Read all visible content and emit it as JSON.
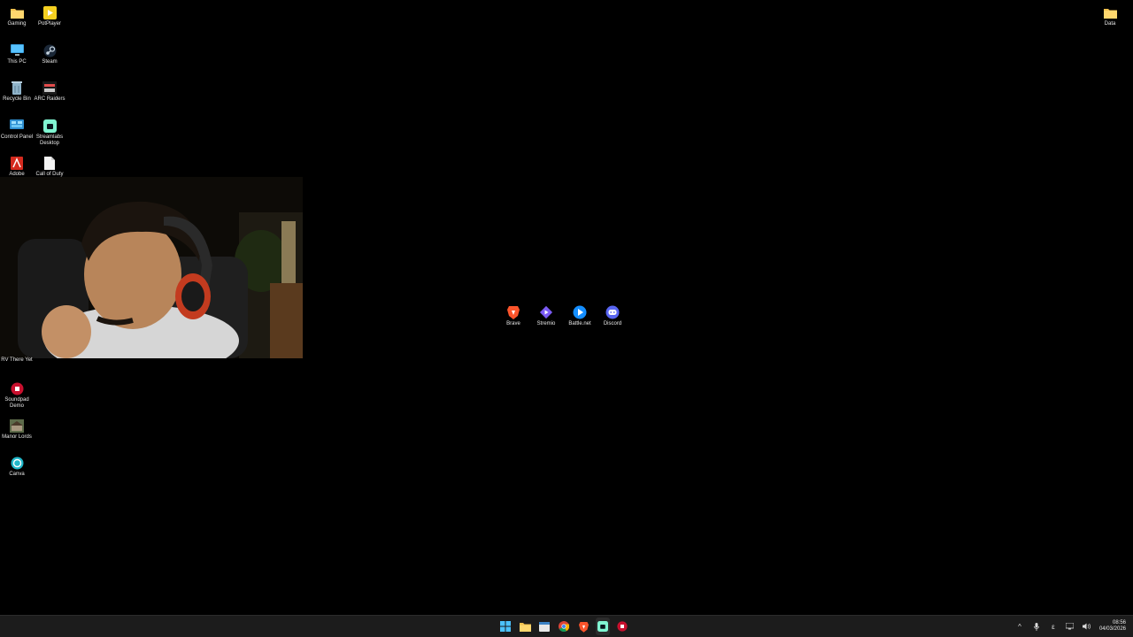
{
  "desktop": {
    "icons": [
      {
        "label": "Gaming",
        "icon": "folder-icon"
      },
      {
        "label": "PotPlayer",
        "icon": "potplayer-icon"
      },
      {
        "label": "This PC",
        "icon": "computer-icon"
      },
      {
        "label": "Steam",
        "icon": "steam-icon"
      },
      {
        "label": "Recycle Bin",
        "icon": "recycle-bin-icon"
      },
      {
        "label": "ARC Raiders",
        "icon": "arc-raiders-icon"
      },
      {
        "label": "Control Panel",
        "icon": "control-panel-icon"
      },
      {
        "label": "Streamlabs Desktop",
        "icon": "streamlabs-icon"
      },
      {
        "label": "Adobe",
        "icon": "adobe-icon"
      },
      {
        "label": "Call of Duty",
        "icon": "file-icon"
      },
      {
        "label": "RV There Yet",
        "icon": "game-icon"
      },
      {
        "label": "Soundpad Demo",
        "icon": "soundpad-icon"
      },
      {
        "label": "Manor Lords",
        "icon": "manor-lords-icon"
      },
      {
        "label": "Canva",
        "icon": "canva-icon"
      },
      {
        "label": "Data",
        "icon": "folder-icon"
      },
      {
        "label": "Brave",
        "icon": "brave-icon"
      },
      {
        "label": "Stremio",
        "icon": "stremio-icon"
      },
      {
        "label": "Battle.net",
        "icon": "battlenet-icon"
      },
      {
        "label": "Discord",
        "icon": "discord-icon"
      }
    ]
  },
  "webcam": {
    "description": "webcam-overlay"
  },
  "taskbar": {
    "apps": [
      {
        "icon": "start-icon"
      },
      {
        "icon": "file-explorer-icon"
      },
      {
        "icon": "calendar-app-icon"
      },
      {
        "icon": "chrome-icon"
      },
      {
        "icon": "brave-icon"
      },
      {
        "icon": "streamlabs-icon"
      },
      {
        "icon": "soundpad-icon"
      }
    ],
    "tray": {
      "chevron": "^",
      "language": "ε",
      "time": "08:56",
      "date": "04/03/2026"
    }
  },
  "colors": {
    "background": "#000000",
    "taskbar": "#1c1c1c",
    "folder": "#f2c14e",
    "brave": "#fb542b",
    "discord": "#5865f2",
    "stremio": "#7b5bf5",
    "battlenet": "#148eff",
    "streamlabs": "#80f5d2"
  }
}
